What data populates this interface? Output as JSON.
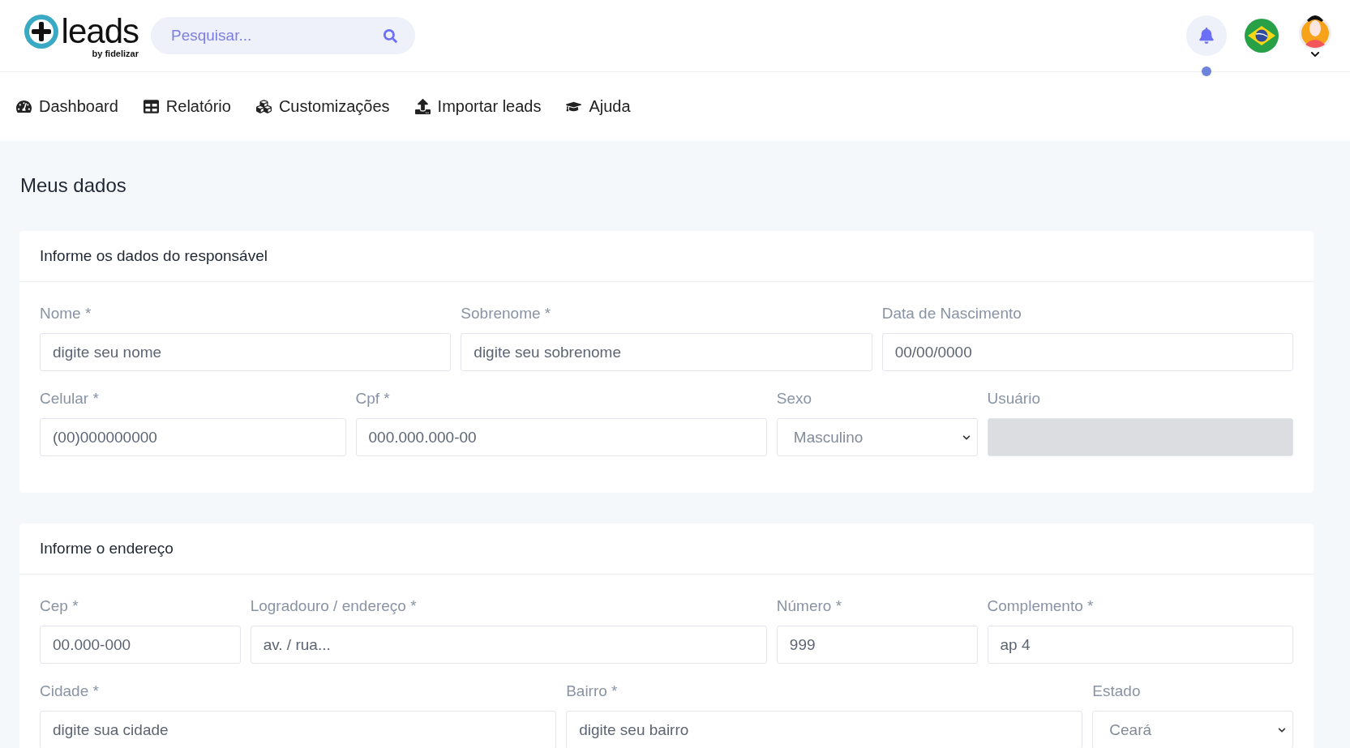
{
  "header": {
    "logo": {
      "word": "leads",
      "byline": "by fidelizar"
    },
    "search": {
      "placeholder": "Pesquisar..."
    }
  },
  "nav": [
    {
      "label": "Dashboard"
    },
    {
      "label": "Relatório"
    },
    {
      "label": "Customizações"
    },
    {
      "label": "Importar leads"
    },
    {
      "label": "Ajuda"
    }
  ],
  "page_title": "Meus dados",
  "sections": [
    {
      "title": "Informe os dados do responsável",
      "rows": [
        {
          "fields": [
            {
              "label": "Nome *",
              "kind": "input",
              "placeholder": "digite seu nome",
              "disabled": false
            },
            {
              "label": "Sobrenome *",
              "kind": "input",
              "placeholder": "digite seu sobrenome",
              "disabled": false
            },
            {
              "label": "Data de Nascimento",
              "kind": "input",
              "placeholder": "00/00/0000",
              "disabled": false
            }
          ]
        },
        {
          "fields": [
            {
              "label": "Celular *",
              "kind": "input",
              "placeholder": "(00)000000000",
              "disabled": false
            },
            {
              "label": "Cpf *",
              "kind": "input",
              "placeholder": "000.000.000-00",
              "disabled": false
            },
            {
              "label": "Sexo",
              "kind": "select",
              "value": "Masculino",
              "disabled": false
            },
            {
              "label": "Usuário",
              "kind": "input",
              "disabled": true
            }
          ]
        }
      ]
    },
    {
      "title": "Informe o endereço",
      "rows": [
        {
          "fields": [
            {
              "label": "Cep *",
              "kind": "input",
              "placeholder": "00.000-000",
              "disabled": false
            },
            {
              "label": "Logradouro / endereço *",
              "kind": "input",
              "placeholder": "av. / rua...",
              "disabled": false
            },
            {
              "label": "Número *",
              "kind": "input",
              "placeholder": "999",
              "disabled": false
            },
            {
              "label": "Complemento *",
              "kind": "input",
              "placeholder": "ap 4",
              "disabled": false
            }
          ]
        },
        {
          "fields": [
            {
              "label": "Cidade *",
              "kind": "input",
              "placeholder": "digite sua cidade",
              "disabled": false
            },
            {
              "label": "Bairro *",
              "kind": "input",
              "placeholder": "digite seu bairro",
              "disabled": false
            },
            {
              "label": "Estado",
              "kind": "select",
              "value": "Ceará",
              "disabled": false
            }
          ]
        }
      ]
    }
  ]
}
